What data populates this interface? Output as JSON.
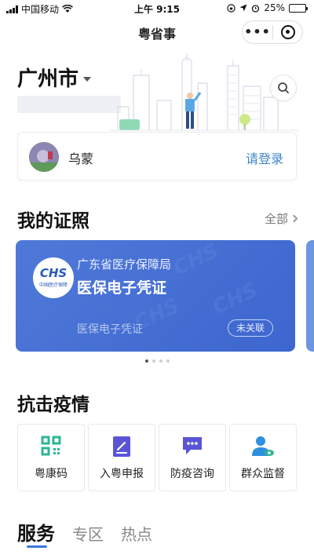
{
  "status_bar": {
    "carrier": "中国移动",
    "time": "上午 9:15",
    "battery": "25%",
    "battery_level": 0.25
  },
  "navbar": {
    "title": "粤省事",
    "more_icon": "more-dots-icon",
    "close_icon": "target-close-icon"
  },
  "header": {
    "city": "广州市"
  },
  "user": {
    "name": "乌蒙",
    "login_label": "请登录"
  },
  "certificates": {
    "title": "我的证照",
    "all_label": "全部",
    "card": {
      "org": "广东省医疗保障局",
      "title": "医保电子凭证",
      "subtitle": "医保电子凭证",
      "badge": "未关联",
      "logo_text": "CHS",
      "logo_sub": "中国医疗保障",
      "watermark": "CHS"
    },
    "pager": {
      "count": 4,
      "active": 0
    }
  },
  "epidemic": {
    "title": "抗击疫情",
    "items": [
      {
        "label": "粤康码",
        "icon": "qr-code-icon",
        "color": "#2fb597"
      },
      {
        "label": "入粤申报",
        "icon": "report-form-icon",
        "color": "#5a55d6"
      },
      {
        "label": "防疫咨询",
        "icon": "chat-bubble-icon",
        "color": "#5a55d6"
      },
      {
        "label": "群众监督",
        "icon": "person-watch-icon",
        "color": "#2f8fe0"
      }
    ]
  },
  "tabs": [
    {
      "label": "服务",
      "active": true
    },
    {
      "label": "专区",
      "active": false
    },
    {
      "label": "热点",
      "active": false
    }
  ],
  "colors": {
    "accent_blue": "#3f85c9",
    "card_blue": "#4670d6",
    "tab_indicator": "#3b77e0"
  }
}
